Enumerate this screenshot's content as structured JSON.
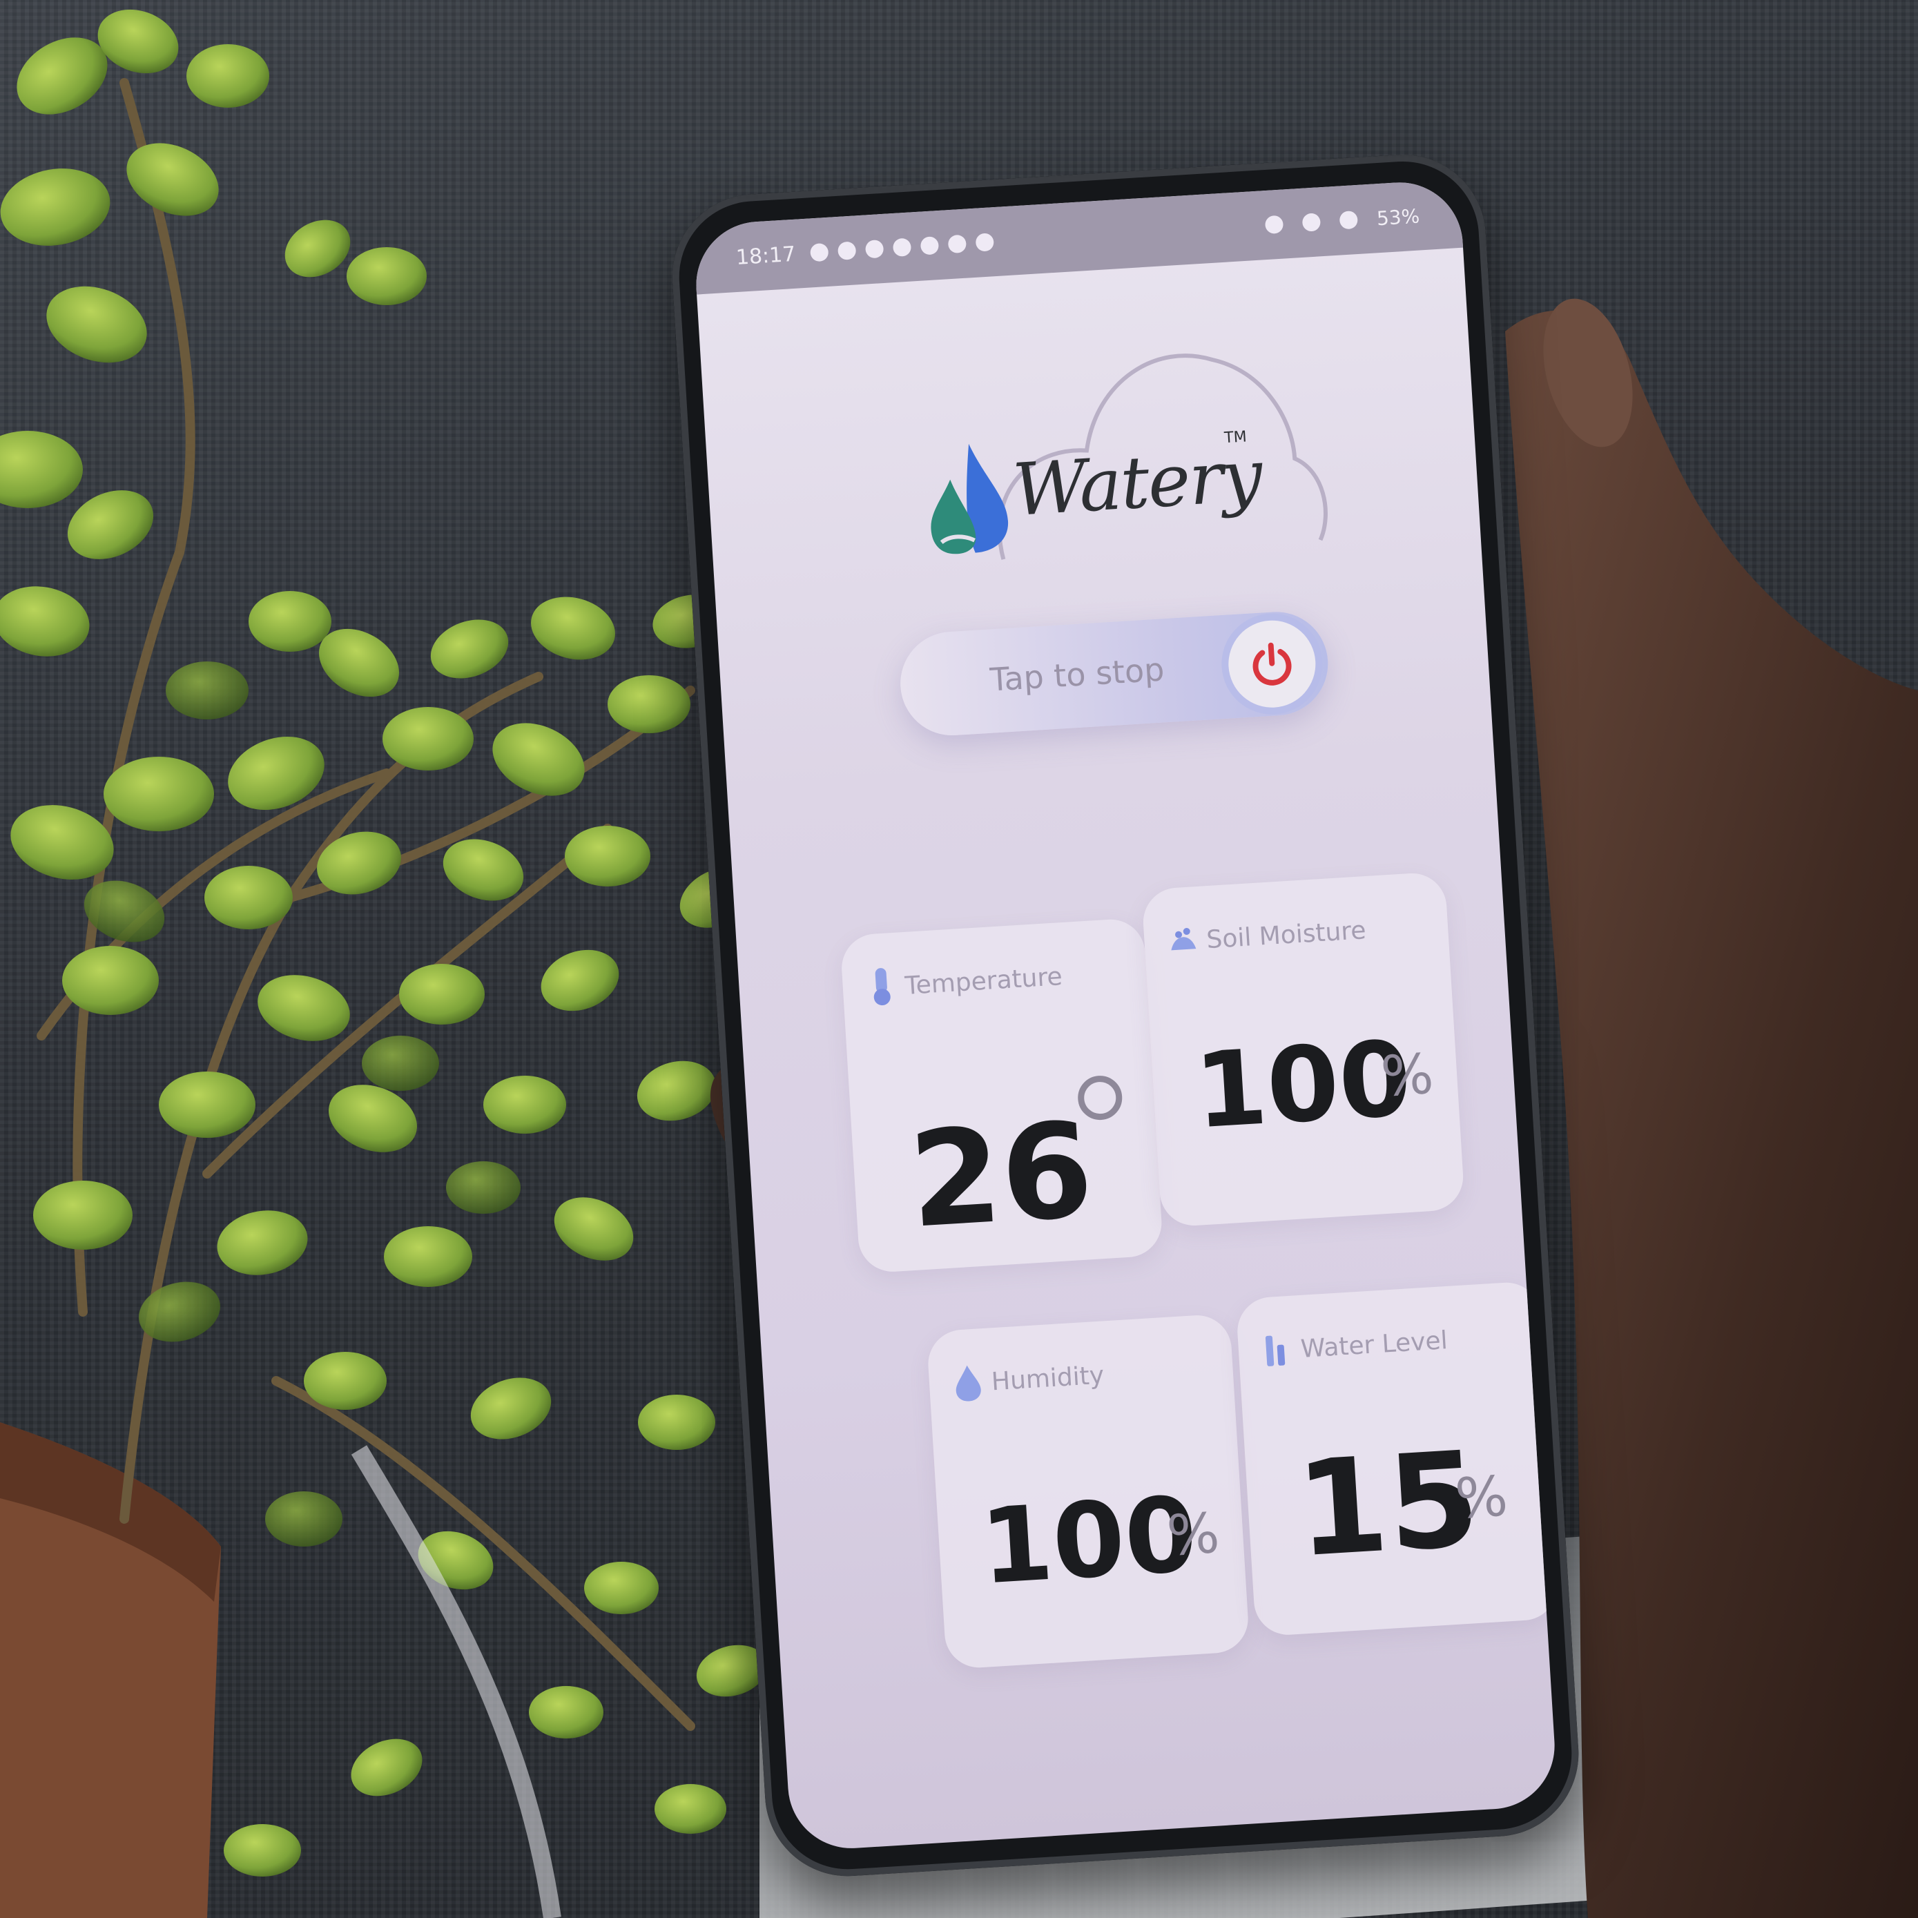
{
  "status_bar": {
    "time": "18:17",
    "battery": "53%"
  },
  "brand": {
    "name": "Watery",
    "trademark": "TM"
  },
  "control": {
    "toggle_label": "Tap to stop",
    "power_icon": "power-icon",
    "power_color": "#d9363e"
  },
  "cards": {
    "temperature": {
      "label": "Temperature",
      "value": "26",
      "unit": "°",
      "icon": "thermometer-icon"
    },
    "soil_moisture": {
      "label": "Soil Moisture",
      "value": "100",
      "unit": "%",
      "icon": "soil-icon"
    },
    "humidity": {
      "label": "Humidity",
      "value": "100",
      "unit": "%",
      "icon": "water-drop-icon"
    },
    "water_level": {
      "label": "Water Level",
      "value": "15",
      "unit": "%",
      "icon": "water-level-icon"
    }
  },
  "colors": {
    "screen_background": "#e4dded",
    "accent_blue": "#7c8ee0",
    "logo_blue": "#3b6fd8",
    "logo_teal": "#2e8b7a"
  }
}
